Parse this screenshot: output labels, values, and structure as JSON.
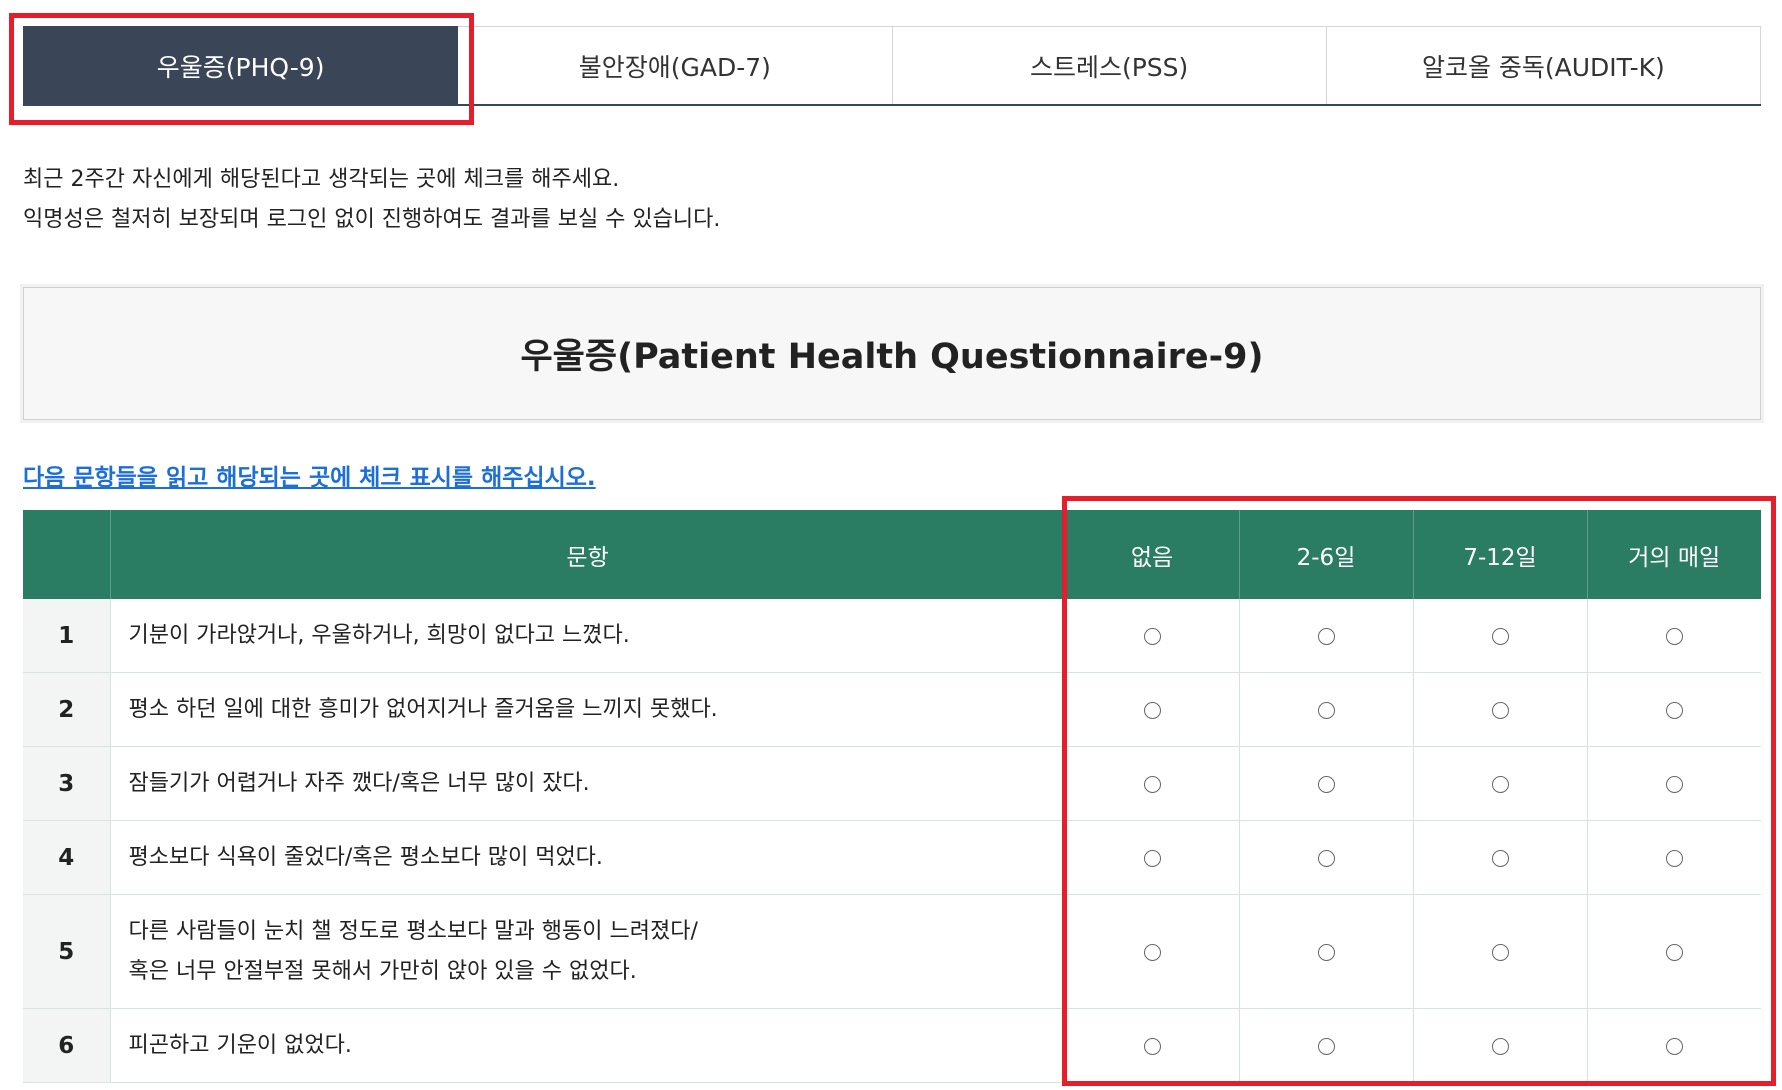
{
  "tabs": [
    "우울증(PHQ-9)",
    "불안장애(GAD-7)",
    "스트레스(PSS)",
    "알코올 중독(AUDIT-K)"
  ],
  "intro": {
    "line1": "최근 2주간 자신에게 해당된다고 생각되는 곳에 체크를 해주세요.",
    "line2": "익명성은 철저히 보장되며 로그인 없이 진행하여도 결과를 보실 수 있습니다."
  },
  "survey_title": "우울증(Patient Health Questionnaire-9)",
  "instruction": "다음 문항들을 읽고 해당되는 곳에 체크 표시를 해주십시오.",
  "table": {
    "headers": {
      "num": "",
      "question": "문항",
      "opt1": "없음",
      "opt2": "2-6일",
      "opt3": "7-12일",
      "opt4": "거의 매일"
    },
    "rows": [
      {
        "num": "1",
        "line1": "기분이 가라앉거나, 우울하거나, 희망이 없다고 느꼈다.",
        "line2": ""
      },
      {
        "num": "2",
        "line1": "평소 하던 일에 대한 흥미가 없어지거나 즐거움을 느끼지 못했다.",
        "line2": ""
      },
      {
        "num": "3",
        "line1": "잠들기가 어렵거나 자주 깼다/혹은 너무 많이 잤다.",
        "line2": ""
      },
      {
        "num": "4",
        "line1": "평소보다 식욕이 줄었다/혹은 평소보다 많이 먹었다.",
        "line2": ""
      },
      {
        "num": "5",
        "line1": "다른 사람들이 눈치 챌 정도로 평소보다 말과 행동이 느려졌다/",
        "line2": "혹은 너무 안절부절 못해서 가만히 앉아 있을 수 없었다."
      },
      {
        "num": "6",
        "line1": "피곤하고 기운이 없었다.",
        "line2": ""
      }
    ]
  },
  "colors": {
    "active_tab": "#3a4657",
    "header_green": "#2a7d62",
    "link_blue": "#1b6fd6",
    "highlight_red": "#e41e2b"
  }
}
